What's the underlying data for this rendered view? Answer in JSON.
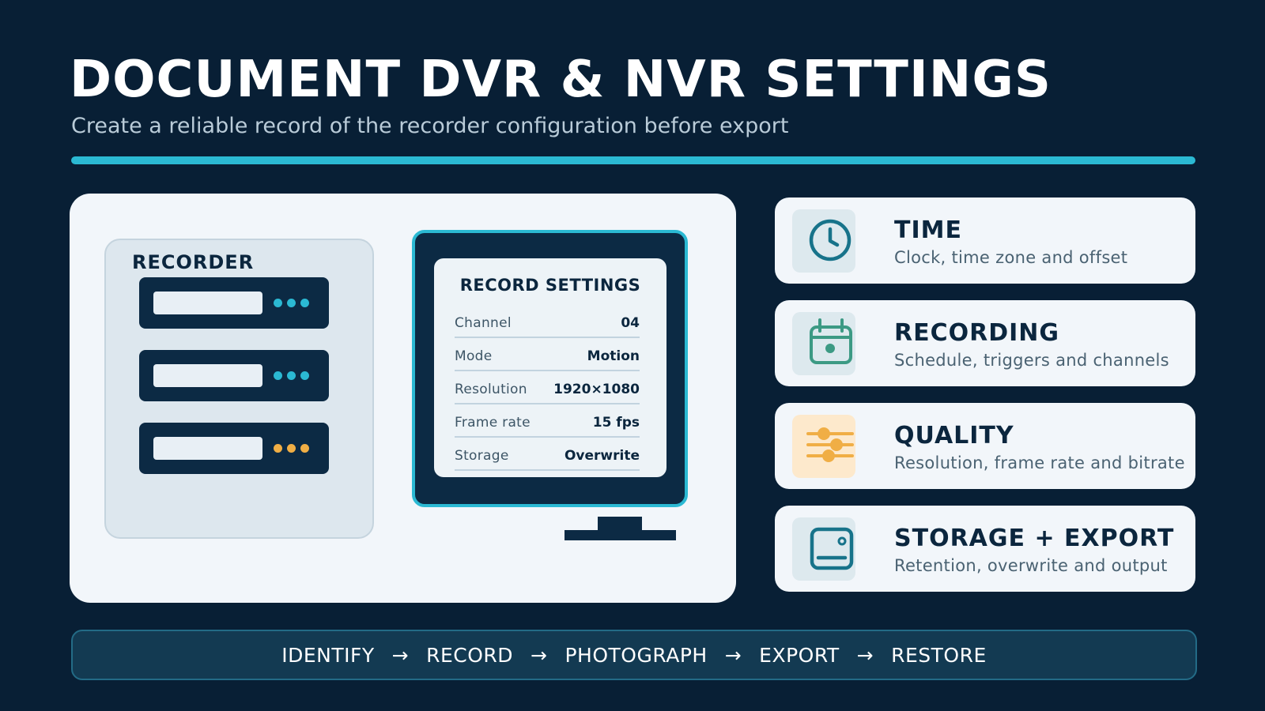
{
  "header": {
    "title": "DOCUMENT DVR & NVR SETTINGS",
    "subtitle": "Create a reliable record of the recorder configuration before export"
  },
  "recorder": {
    "label": "RECORDER",
    "drives": [
      {
        "led_color": "#2bb9d3"
      },
      {
        "led_color": "#2bb9d3"
      },
      {
        "led_color": "#f0ae45"
      }
    ]
  },
  "monitor": {
    "title": "RECORD SETTINGS",
    "rows": [
      {
        "key": "Channel",
        "value": "04"
      },
      {
        "key": "Mode",
        "value": "Motion"
      },
      {
        "key": "Resolution",
        "value": "1920×1080"
      },
      {
        "key": "Frame rate",
        "value": "15 fps"
      },
      {
        "key": "Storage",
        "value": "Overwrite"
      }
    ]
  },
  "cards": [
    {
      "title": "TIME",
      "desc": "Clock, time zone and offset",
      "icon": "clock-icon",
      "accent": "#17738a",
      "icon_bg": "#dde9ee"
    },
    {
      "title": "RECORDING",
      "desc": "Schedule, triggers and channels",
      "icon": "calendar-icon",
      "accent": "#3c9a84",
      "icon_bg": "#dde9ee"
    },
    {
      "title": "QUALITY",
      "desc": "Resolution, frame rate and bitrate",
      "icon": "sliders-icon",
      "accent": "#f0ae45",
      "icon_bg": "#fde9cc"
    },
    {
      "title": "STORAGE + EXPORT",
      "desc": "Retention, overwrite and output",
      "icon": "hard-drive-icon",
      "accent": "#17738a",
      "icon_bg": "#dde9ee"
    }
  ],
  "flow": {
    "steps": [
      "IDENTIFY",
      "RECORD",
      "PHOTOGRAPH",
      "EXPORT",
      "RESTORE"
    ],
    "arrow": "→"
  },
  "colors": {
    "background": "#081f35",
    "accent": "#2bb9d3",
    "panel": "#f2f6fa",
    "dark": "#0c2a44"
  }
}
